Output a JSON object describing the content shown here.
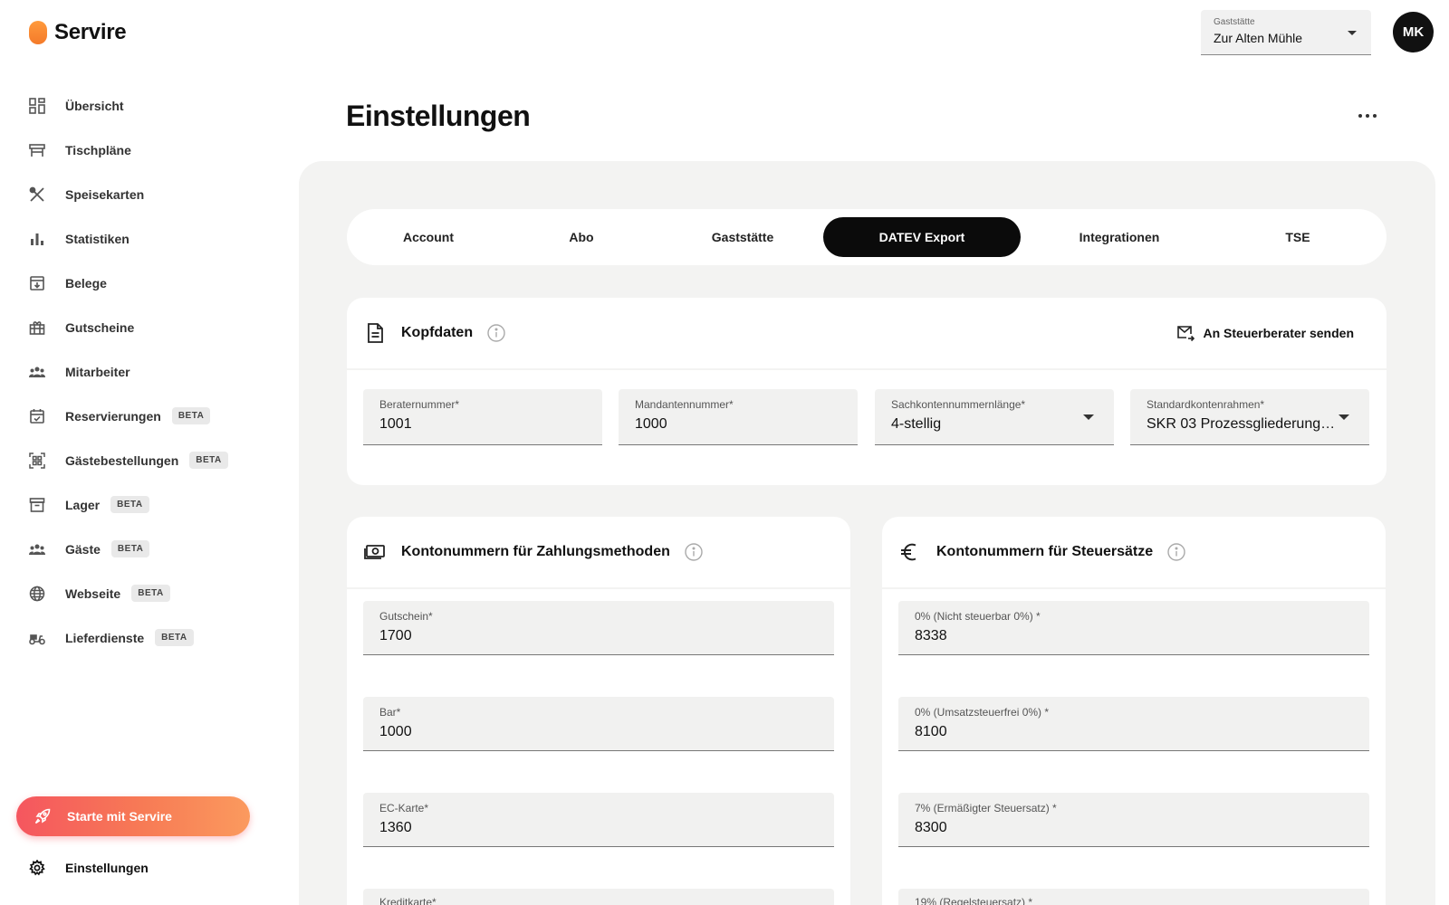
{
  "brand": {
    "name": "Servire",
    "accent": "#f47a2a"
  },
  "sidebar": {
    "items": [
      {
        "icon": "dashboard-icon",
        "label": "Übersicht",
        "badge": ""
      },
      {
        "icon": "table-icon",
        "label": "Tischpläne",
        "badge": ""
      },
      {
        "icon": "cutlery-icon",
        "label": "Speisekarten",
        "badge": ""
      },
      {
        "icon": "bar-chart-icon",
        "label": "Statistiken",
        "badge": ""
      },
      {
        "icon": "receipt-icon",
        "label": "Belege",
        "badge": ""
      },
      {
        "icon": "gift-icon",
        "label": "Gutscheine",
        "badge": ""
      },
      {
        "icon": "people-icon",
        "label": "Mitarbeiter",
        "badge": ""
      },
      {
        "icon": "calendar-check-icon",
        "label": "Reservierungen",
        "badge": "BETA"
      },
      {
        "icon": "qr-code-icon",
        "label": "Gästebestellungen",
        "badge": "BETA"
      },
      {
        "icon": "archive-icon",
        "label": "Lager",
        "badge": "BETA"
      },
      {
        "icon": "guests-icon",
        "label": "Gäste",
        "badge": "BETA"
      },
      {
        "icon": "globe-icon",
        "label": "Webseite",
        "badge": "BETA"
      },
      {
        "icon": "scooter-icon",
        "label": "Lieferdienste",
        "badge": "BETA"
      }
    ],
    "start_button": "Starte mit Servire",
    "settings_label": "Einstellungen"
  },
  "header": {
    "gaststaette_label": "Gaststätte",
    "gaststaette_value": "Zur Alten Mühle",
    "avatar_initials": "MK",
    "page_title": "Einstellungen"
  },
  "tabs": [
    {
      "label": "Account",
      "active": false
    },
    {
      "label": "Abo",
      "active": false
    },
    {
      "label": "Gaststätte",
      "active": false
    },
    {
      "label": "DATEV Export",
      "active": true
    },
    {
      "label": "Integrationen",
      "active": false
    },
    {
      "label": "TSE",
      "active": false
    }
  ],
  "kopfdaten": {
    "title": "Kopfdaten",
    "send_label": "An Steuerberater senden",
    "fields": [
      {
        "label": "Beraternummer*",
        "value": "1001"
      },
      {
        "label": "Mandantennummer*",
        "value": "1000"
      },
      {
        "label": "Sachkontennummernlänge*",
        "value": "4-stellig"
      },
      {
        "label": "Standardkontenrahmen*",
        "value": "SKR 03 Prozessgliederungs..."
      }
    ]
  },
  "zahlungsmethoden": {
    "title": "Kontonummern für Zahlungsmethoden",
    "fields": [
      {
        "label": "Gutschein*",
        "value": "1700"
      },
      {
        "label": "Bar*",
        "value": "1000"
      },
      {
        "label": "EC-Karte*",
        "value": "1360"
      },
      {
        "label": "Kreditkarte*",
        "value": ""
      }
    ]
  },
  "steuersaetze": {
    "title": "Kontonummern für Steuersätze",
    "fields": [
      {
        "label": "0% (Nicht steuerbar 0%) *",
        "value": "8338"
      },
      {
        "label": "0% (Umsatzsteuerfrei 0%) *",
        "value": "8100"
      },
      {
        "label": "7% (Ermäßigter Steuersatz) *",
        "value": "8300"
      },
      {
        "label": "19% (Regelsteuersatz) *",
        "value": ""
      }
    ]
  }
}
